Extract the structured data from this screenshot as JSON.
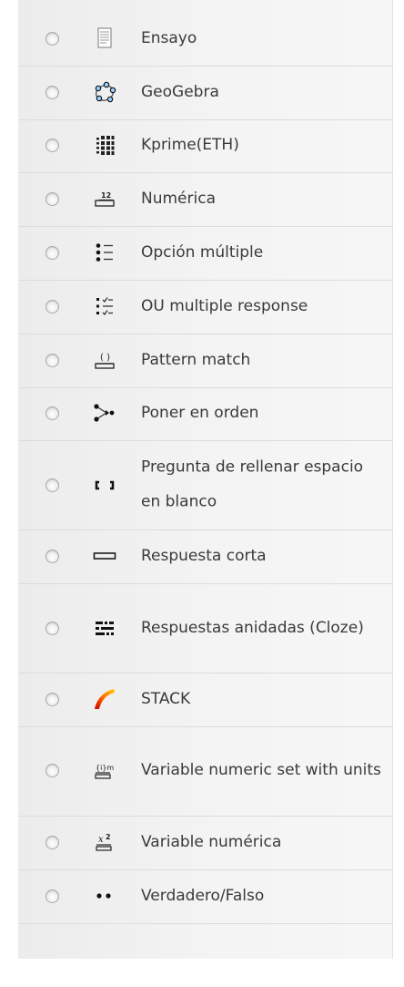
{
  "question_types": [
    {
      "id": "ensayo",
      "label": "Ensayo",
      "icon": "essay-icon"
    },
    {
      "id": "geogebra",
      "label": "GeoGebra",
      "icon": "geogebra-icon"
    },
    {
      "id": "kprime",
      "label": "Kprime(ETH)",
      "icon": "kprime-grid-icon"
    },
    {
      "id": "numerica",
      "label": "Numérica",
      "icon": "numerical-icon"
    },
    {
      "id": "opcion-multiple",
      "label": "Opción múltiple",
      "icon": "multichoice-icon"
    },
    {
      "id": "ou-multiple",
      "label": "OU multiple response",
      "icon": "multiresponse-icon"
    },
    {
      "id": "pattern-match",
      "label": "Pattern match",
      "icon": "pattern-match-icon"
    },
    {
      "id": "poner-en-orden",
      "label": "Poner en orden",
      "icon": "ordering-icon"
    },
    {
      "id": "rellenar",
      "label": "Pregunta de rellenar espacio en blanco",
      "icon": "gapfill-icon"
    },
    {
      "id": "respuesta-corta",
      "label": "Respuesta corta",
      "icon": "short-answer-icon"
    },
    {
      "id": "anidadas",
      "label": "Respuestas anidadas (Cloze)",
      "icon": "cloze-icon"
    },
    {
      "id": "stack",
      "label": "STACK",
      "icon": "stack-icon"
    },
    {
      "id": "varnumunit",
      "label": "Variable numeric set with units",
      "icon": "varnumunit-icon"
    },
    {
      "id": "varnumerica",
      "label": "Variable numérica",
      "icon": "varnumeric-icon"
    },
    {
      "id": "truefalse",
      "label": "Verdadero/Falso",
      "icon": "truefalse-icon"
    }
  ]
}
